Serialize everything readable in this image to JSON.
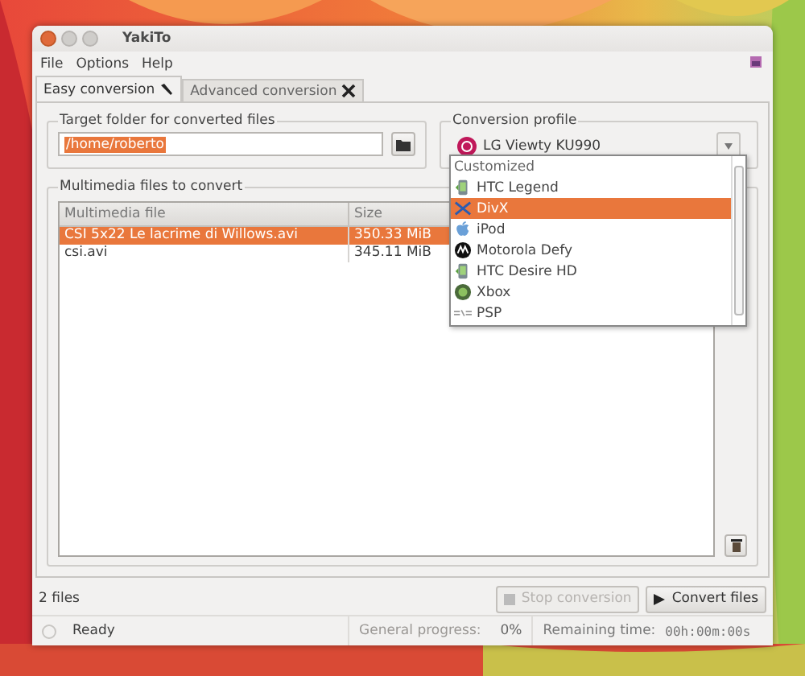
{
  "window": {
    "title": "YakiTo"
  },
  "menu": [
    "File",
    "Options",
    "Help"
  ],
  "tabs": [
    {
      "label": "Easy conversion",
      "selected": true
    },
    {
      "label": "Advanced conversion",
      "selected": false
    }
  ],
  "target_folder": {
    "label": "Target folder for converted files",
    "value": "/home/roberto"
  },
  "conversion_profile": {
    "label": "Conversion profile",
    "value": "LG Viewty KU990",
    "expanded": true,
    "options": [
      {
        "label": "Customized",
        "kind": "header",
        "selected": false
      },
      {
        "label": "HTC Legend",
        "kind": "phone",
        "selected": false
      },
      {
        "label": "DivX",
        "kind": "divx",
        "selected": true
      },
      {
        "label": "iPod",
        "kind": "apple",
        "selected": false
      },
      {
        "label": "Motorola Defy",
        "kind": "motorola",
        "selected": false
      },
      {
        "label": "HTC Desire HD",
        "kind": "phone",
        "selected": false
      },
      {
        "label": "Xbox",
        "kind": "xbox",
        "selected": false
      },
      {
        "label": "PSP",
        "kind": "psp",
        "selected": false
      }
    ]
  },
  "files": {
    "label": "Multimedia files to convert",
    "columns": [
      "Multimedia file",
      "Size"
    ],
    "rows": [
      {
        "name": "CSI 5x22 Le lacrime di Willows.avi",
        "size": "350.33 MiB",
        "selected": true
      },
      {
        "name": "csi.avi",
        "size": "345.11 MiB",
        "selected": false
      }
    ]
  },
  "footer": {
    "count": "2 files",
    "buttons": [
      {
        "label": "Stop conversion",
        "kind": "stop",
        "disabled": true
      },
      {
        "label": "Convert files",
        "kind": "play",
        "disabled": false
      }
    ]
  },
  "status": {
    "state": "Ready",
    "progress_label": "General progress:",
    "progress": "0%",
    "remaining_label": "Remaining time:",
    "remaining": "00h:00m:00s"
  }
}
